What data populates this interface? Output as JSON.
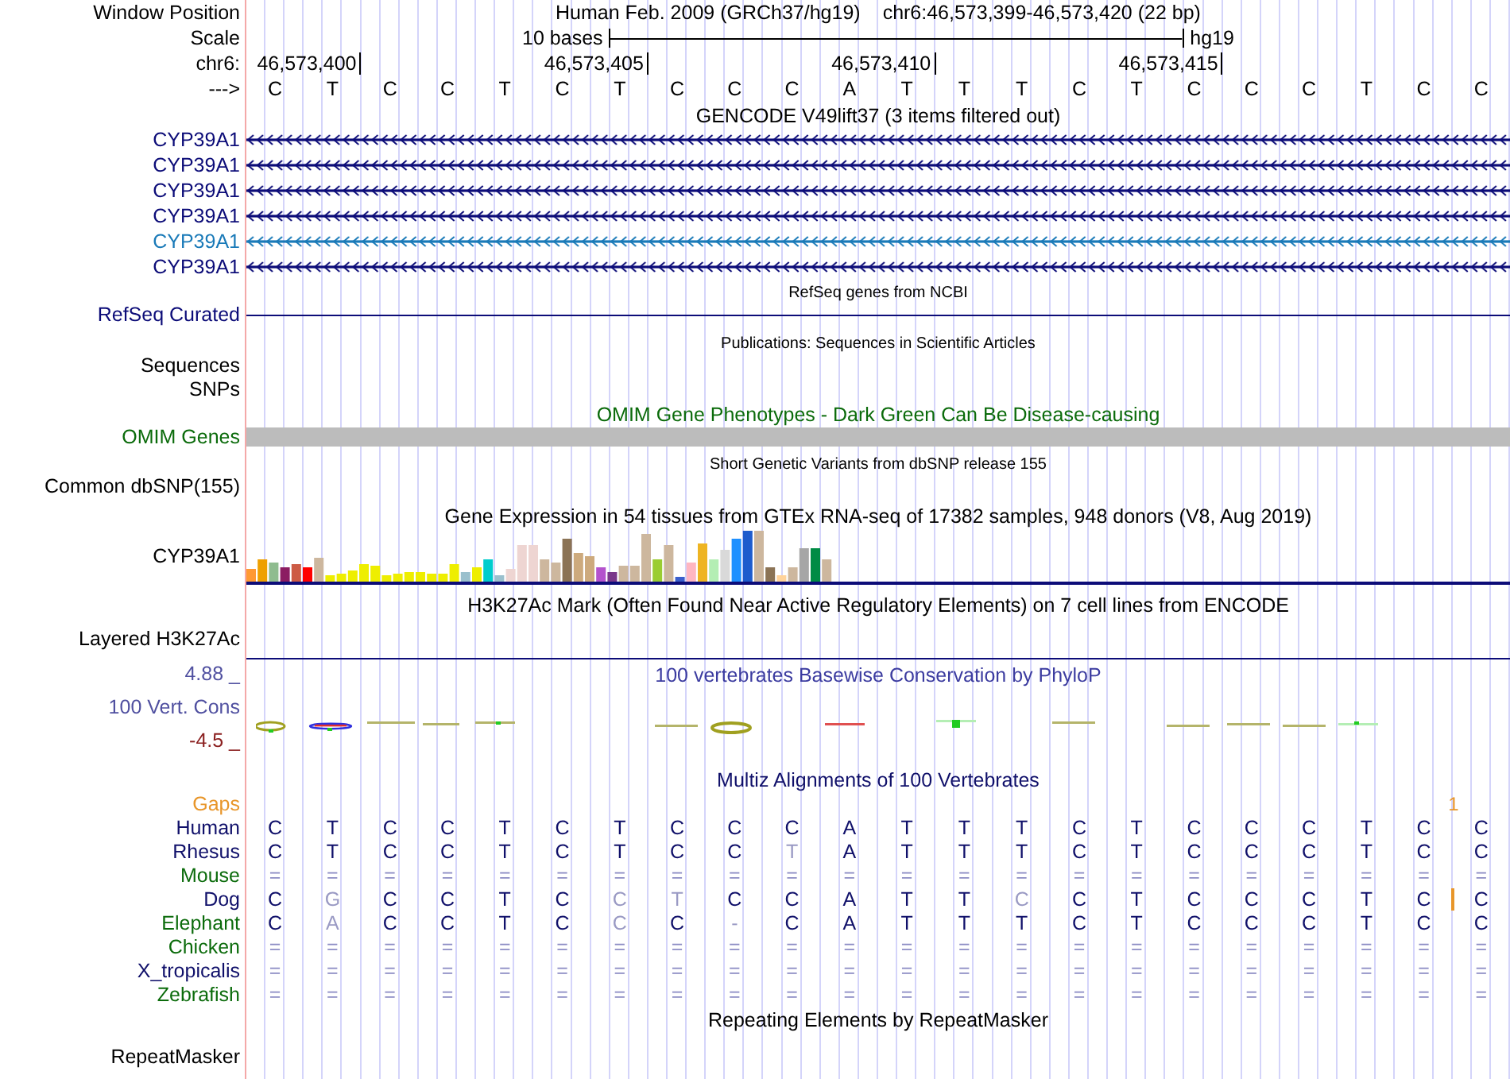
{
  "header": {
    "label": "Window Position",
    "assembly": "Human Feb. 2009 (GRCh37/hg19)",
    "position": "chr6:46,573,399-46,573,420 (22 bp)"
  },
  "scale": {
    "label": "Scale",
    "text": "10 bases",
    "assembly": "hg19"
  },
  "coordinates": {
    "label": "chr6:",
    "ticks": [
      "46,573,400",
      "46,573,405",
      "46,573,410",
      "46,573,415"
    ]
  },
  "sequence": {
    "label": "--->",
    "bases": [
      "C",
      "T",
      "C",
      "C",
      "T",
      "C",
      "T",
      "C",
      "C",
      "C",
      "A",
      "T",
      "T",
      "T",
      "C",
      "T",
      "C",
      "C",
      "C",
      "T",
      "C",
      "C"
    ]
  },
  "tracks": [
    {
      "kind": "genes",
      "title": "GENCODE V49lift37 (3 items filtered out)",
      "small_title": false,
      "color": "#000000",
      "items": [
        {
          "name": "CYP39A1",
          "color": "#0c0c78"
        },
        {
          "name": "CYP39A1",
          "color": "#0c0c78"
        },
        {
          "name": "CYP39A1",
          "color": "#0c0c78"
        },
        {
          "name": "CYP39A1",
          "color": "#0c0c78"
        },
        {
          "name": "CYP39A1",
          "color": "#1a7ab8"
        },
        {
          "name": "CYP39A1",
          "color": "#0c0c78"
        }
      ]
    },
    {
      "kind": "line",
      "title": "RefSeq genes from NCBI",
      "small_title": true,
      "color": "#000000",
      "label": "RefSeq Curated"
    },
    {
      "kind": "empty",
      "title": "Publications: Sequences in Scientific Articles",
      "small_title": true,
      "color": "#000000",
      "labels": [
        "Sequences",
        "SNPs"
      ]
    },
    {
      "kind": "bar",
      "title": "OMIM Gene Phenotypes - Dark Green Can Be Disease-causing",
      "small_title": false,
      "color": "#0b6b0b",
      "label": "OMIM Genes"
    },
    {
      "kind": "empty",
      "title": "Short Genetic Variants from dbSNP release 155",
      "small_title": true,
      "color": "#000000",
      "labels": [
        "Common dbSNP(155)"
      ]
    },
    {
      "kind": "expression",
      "title": "Gene Expression in 54 tissues from GTEx RNA-seq of 17382 samples, 948 donors (V8, Aug 2019)",
      "small_title": false,
      "color": "#000000",
      "label": "CYP39A1"
    },
    {
      "kind": "signal",
      "title": "H3K27Ac Mark (Often Found Near Active Regulatory Elements) on 7 cell lines from ENCODE",
      "small_title": false,
      "color": "#000000",
      "label": "Layered H3K27Ac"
    },
    {
      "kind": "wiggle",
      "title": "100 vertebrates Basewise Conservation by PhyloP",
      "small_title": false,
      "color": "#3c3ca0",
      "label": "100 Vert. Cons",
      "max": "4.88 _",
      "min": "-4.5 _"
    },
    {
      "kind": "alignment",
      "title": "Multiz Alignments of 100 Vertebrates",
      "small_title": false,
      "color": "#10106a",
      "gaps": {
        "label": "Gaps",
        "count": "1",
        "after": [
          false,
          false,
          false,
          false,
          false,
          false,
          false,
          false,
          false,
          false,
          false,
          false,
          false,
          false,
          false,
          false,
          false,
          false,
          false,
          false,
          true,
          false
        ]
      },
      "species": [
        {
          "name": "Human",
          "color": "#10106a",
          "kind": "bases",
          "bases": [
            "C",
            "T",
            "C",
            "C",
            "T",
            "C",
            "T",
            "C",
            "C",
            "C",
            "A",
            "T",
            "T",
            "T",
            "C",
            "T",
            "C",
            "C",
            "C",
            "T",
            "C",
            "C"
          ],
          "faded": [
            false,
            false,
            false,
            false,
            false,
            false,
            false,
            false,
            false,
            false,
            false,
            false,
            false,
            false,
            false,
            false,
            false,
            false,
            false,
            false,
            false,
            false
          ]
        },
        {
          "name": "Rhesus",
          "color": "#10106a",
          "kind": "bases",
          "bases": [
            "C",
            "T",
            "C",
            "C",
            "T",
            "C",
            "T",
            "C",
            "C",
            "T",
            "A",
            "T",
            "T",
            "T",
            "C",
            "T",
            "C",
            "C",
            "C",
            "T",
            "C",
            "C"
          ],
          "faded": [
            false,
            false,
            false,
            false,
            false,
            false,
            false,
            false,
            false,
            true,
            false,
            false,
            false,
            false,
            false,
            false,
            false,
            false,
            false,
            false,
            false,
            false
          ]
        },
        {
          "name": "Mouse",
          "color": "#0b6b0b",
          "kind": "unaligned",
          "bases": [
            "=",
            "=",
            "=",
            "=",
            "=",
            "=",
            "=",
            "=",
            "=",
            "=",
            "=",
            "=",
            "=",
            "=",
            "=",
            "=",
            "=",
            "=",
            "=",
            "=",
            "=",
            "="
          ]
        },
        {
          "name": "Dog",
          "color": "#10106a",
          "kind": "bases",
          "bases": [
            "C",
            "G",
            "C",
            "C",
            "T",
            "C",
            "C",
            "T",
            "C",
            "C",
            "A",
            "T",
            "T",
            "C",
            "C",
            "T",
            "C",
            "C",
            "C",
            "T",
            "C",
            "C"
          ],
          "faded": [
            false,
            true,
            false,
            false,
            false,
            false,
            true,
            true,
            false,
            false,
            false,
            false,
            false,
            true,
            false,
            false,
            false,
            false,
            false,
            false,
            false,
            false
          ],
          "insertion": [
            false,
            false,
            false,
            false,
            false,
            false,
            false,
            false,
            false,
            false,
            false,
            false,
            false,
            false,
            false,
            false,
            false,
            false,
            false,
            false,
            true,
            false
          ]
        },
        {
          "name": "Elephant",
          "color": "#0b6b0b",
          "kind": "bases",
          "bases": [
            "C",
            "A",
            "C",
            "C",
            "T",
            "C",
            "C",
            "C",
            "-",
            "C",
            "A",
            "T",
            "T",
            "T",
            "C",
            "T",
            "C",
            "C",
            "C",
            "T",
            "C",
            "C"
          ],
          "faded": [
            false,
            true,
            false,
            false,
            false,
            false,
            true,
            false,
            true,
            false,
            false,
            false,
            false,
            false,
            false,
            false,
            false,
            false,
            false,
            false,
            false,
            false
          ]
        },
        {
          "name": "Chicken",
          "color": "#0b6b0b",
          "kind": "unaligned",
          "bases": [
            "=",
            "=",
            "=",
            "=",
            "=",
            "=",
            "=",
            "=",
            "=",
            "=",
            "=",
            "=",
            "=",
            "=",
            "=",
            "=",
            "=",
            "=",
            "=",
            "=",
            "=",
            "="
          ]
        },
        {
          "name": "X_tropicalis",
          "color": "#10106a",
          "kind": "unaligned",
          "bases": [
            "=",
            "=",
            "=",
            "=",
            "=",
            "=",
            "=",
            "=",
            "=",
            "=",
            "=",
            "=",
            "=",
            "=",
            "=",
            "=",
            "=",
            "=",
            "=",
            "=",
            "=",
            "="
          ]
        },
        {
          "name": "Zebrafish",
          "color": "#0b6b0b",
          "kind": "unaligned",
          "bases": [
            "=",
            "=",
            "=",
            "=",
            "=",
            "=",
            "=",
            "=",
            "=",
            "=",
            "=",
            "=",
            "=",
            "=",
            "=",
            "=",
            "=",
            "=",
            "=",
            "=",
            "=",
            "="
          ]
        }
      ]
    },
    {
      "kind": "empty",
      "title": "Repeating Elements by RepeatMasker",
      "small_title": false,
      "color": "#000000",
      "labels": [
        "RepeatMasker"
      ]
    }
  ]
}
